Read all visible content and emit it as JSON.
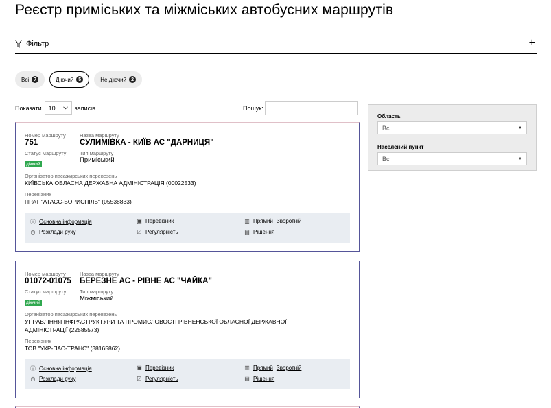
{
  "page": {
    "title": "Реєстр приміських та міжміських автобусних маршрутів"
  },
  "filter": {
    "label": "Фільтр",
    "toggle": "+"
  },
  "chips": [
    {
      "label": "Всі",
      "count": "7",
      "active": false
    },
    {
      "label": "Діючий",
      "count": "5",
      "active": true
    },
    {
      "label": "Не діючий",
      "count": "2",
      "active": false
    }
  ],
  "table_controls": {
    "show_label": "Показати",
    "page_size": "10",
    "records_label": "записів",
    "search_label": "Пошук:",
    "search_value": ""
  },
  "side_filters": {
    "region_label": "Область",
    "region_value": "Всі",
    "locality_label": "Населений пункт",
    "locality_value": "Всі"
  },
  "field_labels": {
    "route_number": "Номер маршруту",
    "route_name": "Назва маршруту",
    "route_status": "Статус маршруту",
    "route_type": "Тип маршруту",
    "organizer": "Організатор пасажирських перевезень",
    "carrier": "Перевізник"
  },
  "link_labels": {
    "main_info": "Основна інформація",
    "carrier": "Перевізник",
    "forward": "Прямий",
    "reverse": "Зворотній",
    "schedule": "Розклади руху",
    "regularity": "Регулярність",
    "decisions": "Рішення"
  },
  "routes": [
    {
      "number": "751",
      "name": "СУЛИМІВКА - КИЇВ АС \"ДАРНИЦЯ\"",
      "status": "діючий",
      "type": "Приміський",
      "organizer": "КИЇВСЬКА ОБЛАСНА ДЕРЖАВНА АДМІНІСТРАЦІЯ (00022533)",
      "carrier": "ПРАТ \"АТАСС-БОРИСПІЛЬ\" (05538833)"
    },
    {
      "number": "01072-01075",
      "name": "БЕРЕЗНЕ АС - РІВНЕ АС \"ЧАЙКА\"",
      "status": "діючий",
      "type": "Міжміський",
      "organizer": "УПРАВЛІННЯ ІНФРАСТРУКТУРИ ТА ПРОМИСЛОВОСТІ РІВНЕНСЬКОЇ ОБЛАСНОЇ ДЕРЖАВНОЇ АДМІНІСТРАЦІЇ (22585573)",
      "carrier": "ТОВ \"УКР-ПАС-ТРАНС\" (38165862)"
    }
  ],
  "colors": {
    "status_active": "#2fa84f",
    "links_bg": "#e9edf2",
    "panel_bg": "#ececec"
  }
}
